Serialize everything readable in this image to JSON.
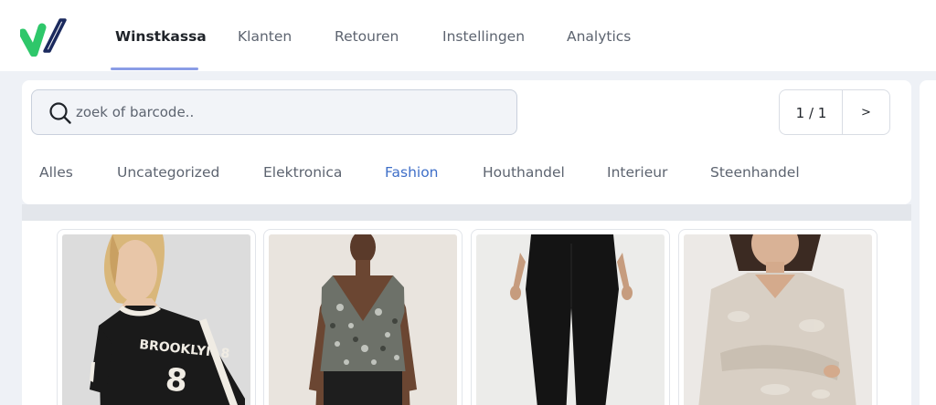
{
  "nav": {
    "items": [
      {
        "label": "Winstkassa",
        "active": true
      },
      {
        "label": "Klanten",
        "active": false
      },
      {
        "label": "Retouren",
        "active": false
      },
      {
        "label": "Instellingen",
        "active": false
      },
      {
        "label": "Analytics",
        "active": false
      }
    ]
  },
  "search": {
    "placeholder": "zoek of barcode..",
    "value": ""
  },
  "pager": {
    "count": "1 / 1",
    "next_label": ">"
  },
  "categories": {
    "items": [
      {
        "label": "Alles",
        "active": false
      },
      {
        "label": "Uncategorized",
        "active": false
      },
      {
        "label": "Elektronica",
        "active": false
      },
      {
        "label": "Fashion",
        "active": true
      },
      {
        "label": "Houthandel",
        "active": false
      },
      {
        "label": "Interieur",
        "active": false
      },
      {
        "label": "Steenhandel",
        "active": false
      }
    ]
  },
  "products": {
    "items": [
      {
        "image": "black-lace-jersey-top-photo",
        "print": "BROOKLYN 8"
      },
      {
        "image": "sequin-v-neck-top-photo"
      },
      {
        "image": "black-flared-trousers-photo"
      },
      {
        "image": "beige-satin-blouse-photo"
      }
    ]
  },
  "colors": {
    "accent": "#3f6fc8",
    "underline": "#8a9de6",
    "logo_green": "#2ec76a",
    "logo_navy": "#1b2a5e",
    "background": "#eef1f6"
  }
}
